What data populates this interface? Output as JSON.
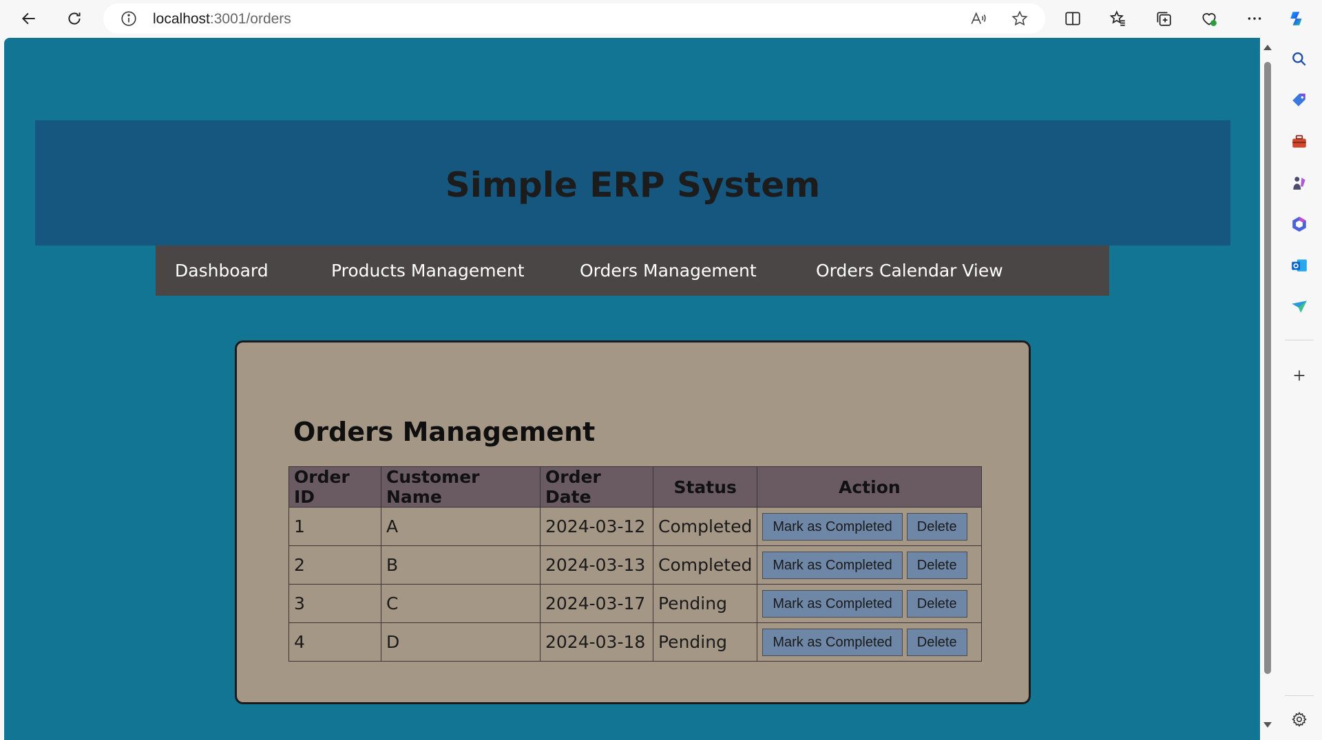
{
  "browser": {
    "url_host": "localhost",
    "url_rest": ":3001/orders",
    "icons": {
      "back": "back-arrow-icon",
      "reload": "reload-icon",
      "info": "info-icon",
      "read_aloud": "read-aloud-icon",
      "favorite": "star-icon",
      "split": "split-screen-icon",
      "favorites": "favorites-icon",
      "collections": "collections-icon",
      "health": "browser-essentials-icon",
      "more": "more-icon",
      "copilot": "copilot-icon"
    }
  },
  "sidebar_icons": [
    "search-icon",
    "shopping-tag-icon",
    "tools-icon",
    "games-icon",
    "office-icon",
    "outlook-icon",
    "drop-icon",
    "add-icon",
    "settings-icon"
  ],
  "app": {
    "title": "Simple ERP System",
    "nav": [
      {
        "label": "Dashboard"
      },
      {
        "label": "Products Management"
      },
      {
        "label": "Orders Management"
      },
      {
        "label": "Orders Calendar View"
      }
    ],
    "section_title": "Orders Management",
    "table": {
      "headers": [
        "Order ID",
        "Customer Name",
        "Order Date",
        "Status",
        "Action"
      ],
      "rows": [
        {
          "id": "1",
          "customer": "A",
          "date": "2024-03-12",
          "status": "Completed"
        },
        {
          "id": "2",
          "customer": "B",
          "date": "2024-03-13",
          "status": "Completed"
        },
        {
          "id": "3",
          "customer": "C",
          "date": "2024-03-17",
          "status": "Pending"
        },
        {
          "id": "4",
          "customer": "D",
          "date": "2024-03-18",
          "status": "Pending"
        }
      ],
      "complete_label": "Mark as Completed",
      "delete_label": "Delete"
    }
  },
  "colors": {
    "page_bg": "#137594",
    "header_bg": "#16577f",
    "nav_bg": "#4a4646",
    "card_bg": "#a59786",
    "table_header_bg": "#6a5b63",
    "button_bg": "#6e87a6"
  }
}
